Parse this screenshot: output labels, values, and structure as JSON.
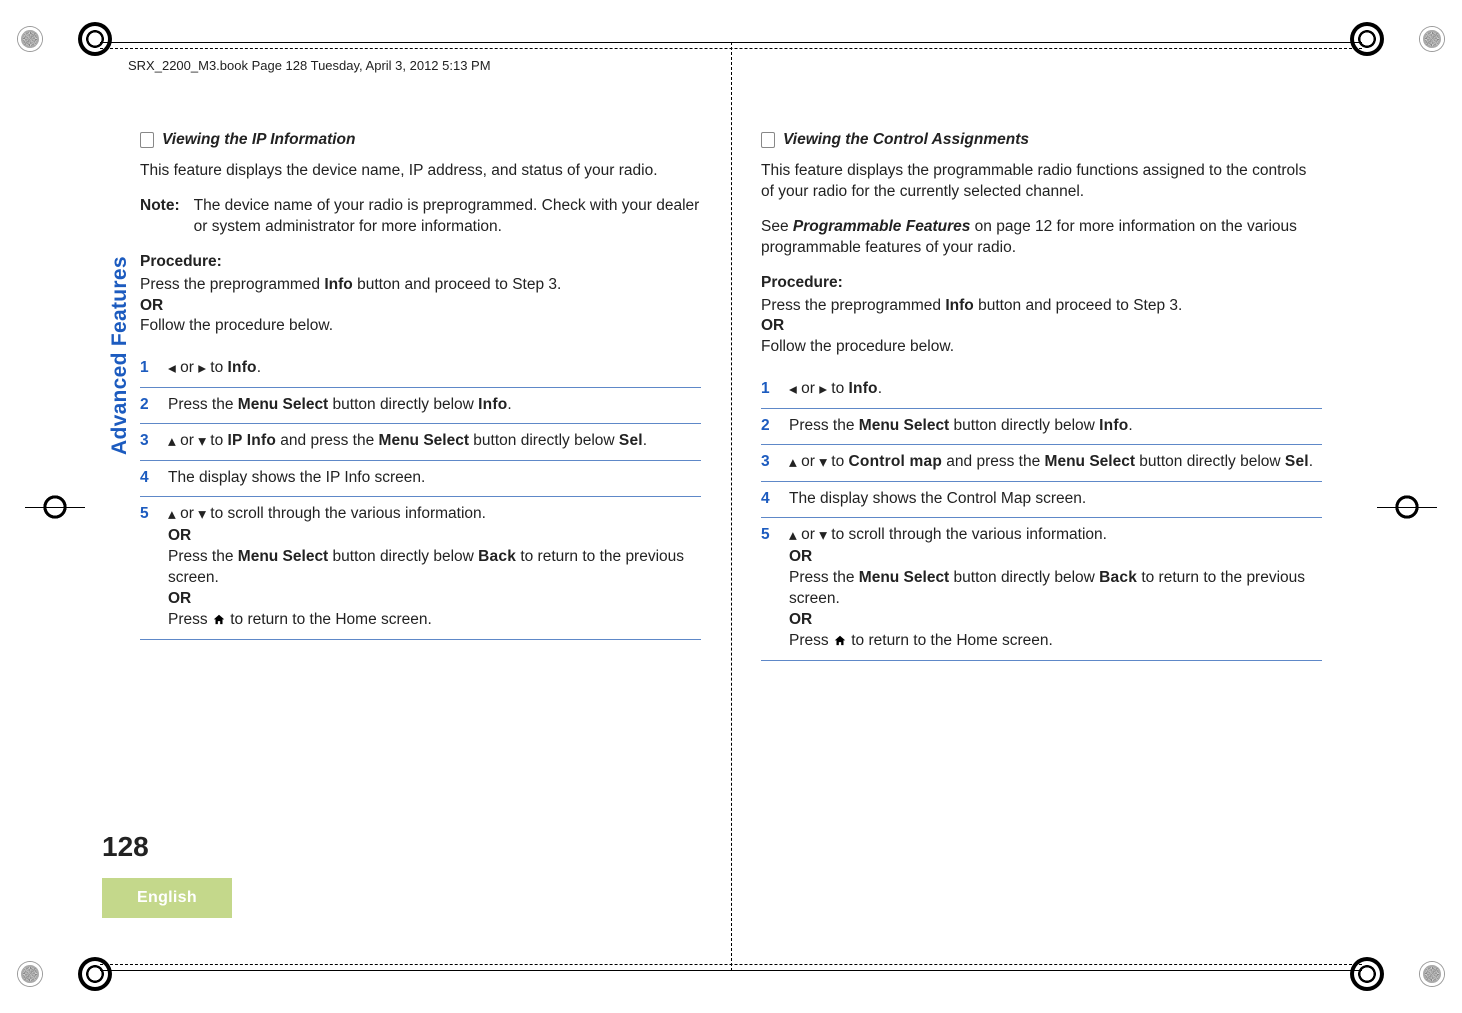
{
  "header": "SRX_2200_M3.book  Page 128  Tuesday, April 3, 2012  5:13 PM",
  "side_tab": "Advanced Features",
  "page_number": "128",
  "language": "English",
  "left": {
    "title": "Viewing the IP Information",
    "intro": "This feature displays the device name, IP address, and status of your radio.",
    "note_label": "Note:",
    "note_text": "The device name of your radio is preprogrammed. Check with your dealer or system administrator for more information.",
    "proc_label": "Procedure:",
    "proc_pre1_a": "Press the preprogrammed ",
    "proc_pre1_b": "Info",
    "proc_pre1_c": " button and proceed to Step 3.",
    "or": "OR",
    "proc_pre2": "Follow the procedure below.",
    "s1_a": " or ",
    "s1_b": " to ",
    "s1_c": "Info",
    "s1_d": ".",
    "s2_a": "Press the ",
    "s2_b": "Menu Select",
    "s2_c": " button directly below ",
    "s2_d": "Info",
    "s2_e": ".",
    "s3_a": " or ",
    "s3_b": " to ",
    "s3_c": "IP Info",
    "s3_d": " and press the ",
    "s3_e": "Menu Select",
    "s3_f": " button directly below ",
    "s3_g": "Sel",
    "s3_h": ".",
    "s4": "The display shows the IP Info screen.",
    "s5_a": " or ",
    "s5_b": " to scroll through the various information.",
    "s5_c": "Press the ",
    "s5_d": "Menu Select",
    "s5_e": " button directly below ",
    "s5_f": "Back",
    "s5_g": " to return to the previous screen.",
    "s5_h": "Press ",
    "s5_i": " to return to the Home screen."
  },
  "right": {
    "title": "Viewing the Control Assignments",
    "intro": "This feature displays the programmable radio functions assigned to the controls of your radio for the currently selected channel.",
    "see_a": "See ",
    "see_b": "Programmable Features",
    "see_c": " on page 12 for more information on the various programmable features of your radio.",
    "proc_label": "Procedure:",
    "proc_pre1_a": "Press the preprogrammed ",
    "proc_pre1_b": "Info",
    "proc_pre1_c": " button and proceed to Step 3.",
    "or": "OR",
    "proc_pre2": "Follow the procedure below.",
    "s1_a": " or ",
    "s1_b": " to ",
    "s1_c": "Info",
    "s1_d": ".",
    "s2_a": "Press the ",
    "s2_b": "Menu Select",
    "s2_c": " button directly below ",
    "s2_d": "Info",
    "s2_e": ".",
    "s3_a": " or ",
    "s3_b": " to ",
    "s3_c": "Control map",
    "s3_d": " and press the ",
    "s3_e": "Menu Select",
    "s3_f": " button directly below ",
    "s3_g": "Sel",
    "s3_h": ".",
    "s4": "The display shows the Control Map screen.",
    "s5_a": " or ",
    "s5_b": " to scroll through the various information.",
    "s5_c": "Press the ",
    "s5_d": "Menu Select",
    "s5_e": " button directly below ",
    "s5_f": "Back",
    "s5_g": " to return to the previous screen.",
    "s5_h": "Press ",
    "s5_i": " to return to the Home screen."
  },
  "step_nums": {
    "n1": "1",
    "n2": "2",
    "n3": "3",
    "n4": "4",
    "n5": "5"
  }
}
